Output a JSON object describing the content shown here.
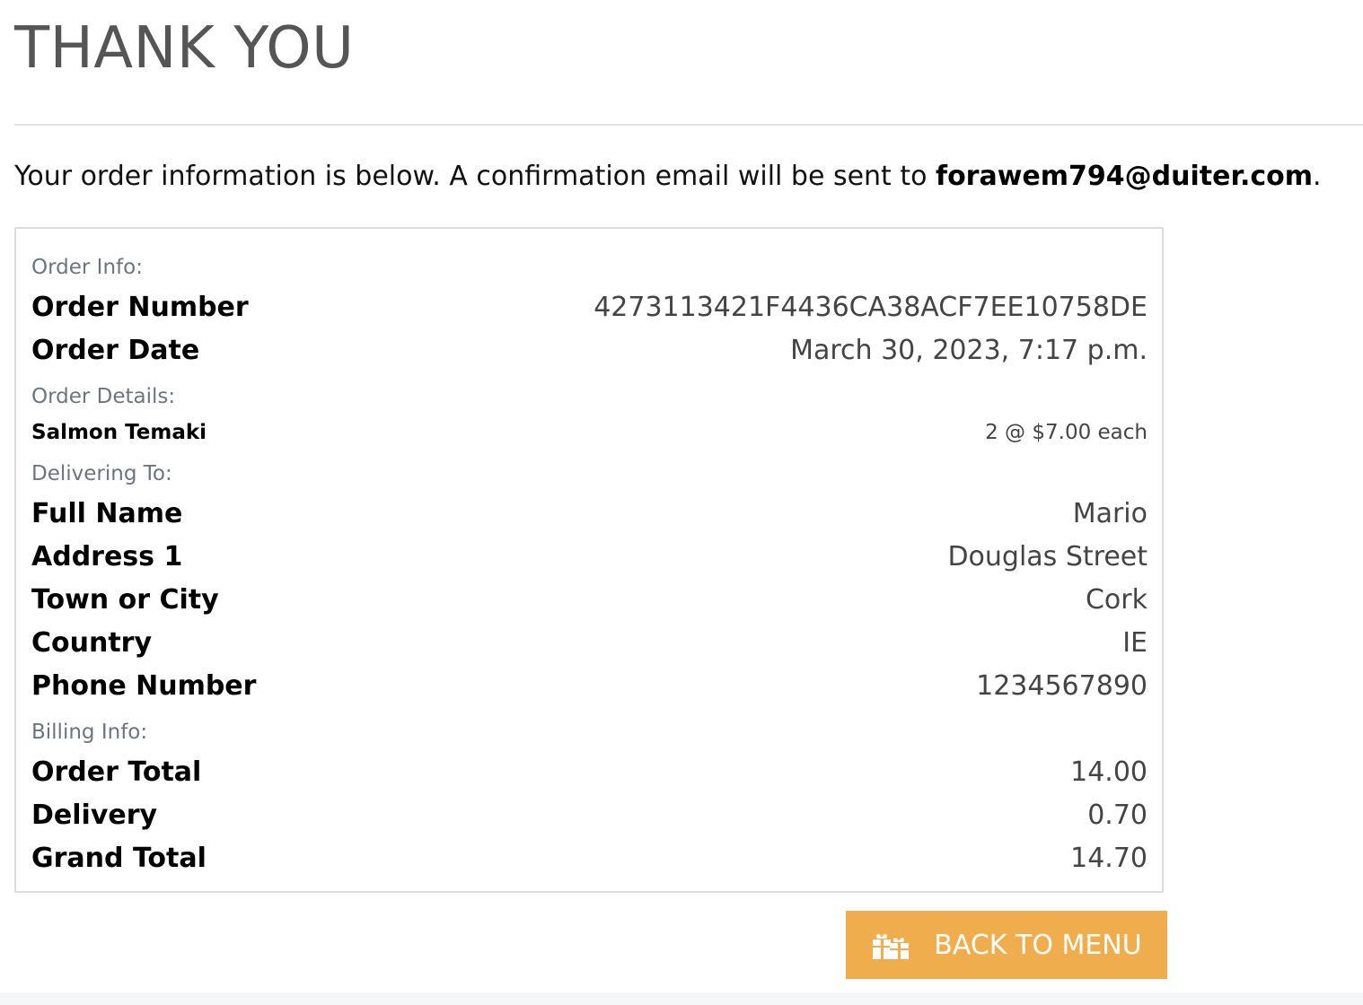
{
  "page": {
    "title": "THANK YOU",
    "intro_prefix": "Your order information is below. A confirmation email will be sent to ",
    "intro_email": "forawem794@duiter.com",
    "intro_suffix": "."
  },
  "order_info": {
    "label": "Order Info:",
    "order_number_label": "Order Number",
    "order_number": "4273113421F4436CA38ACF7EE10758DE",
    "order_date_label": "Order Date",
    "order_date": "March 30, 2023, 7:17 p.m."
  },
  "order_details": {
    "label": "Order Details:",
    "items": [
      {
        "name": "Salmon Temaki",
        "qty_price": "2 @ $7.00 each"
      }
    ]
  },
  "delivering_to": {
    "label": "Delivering To:",
    "full_name_label": "Full Name",
    "full_name": "Mario",
    "address1_label": "Address 1",
    "address1": "Douglas Street",
    "town_label": "Town or City",
    "town": "Cork",
    "country_label": "Country",
    "country": "IE",
    "phone_label": "Phone Number",
    "phone": "1234567890"
  },
  "billing_info": {
    "label": "Billing Info:",
    "order_total_label": "Order Total",
    "order_total": "14.00",
    "delivery_label": "Delivery",
    "delivery": "0.70",
    "grand_total_label": "Grand Total",
    "grand_total": "14.70"
  },
  "actions": {
    "back_label": "BACK TO MENU",
    "back_icon": "gifts-icon"
  },
  "colors": {
    "button": "#f0ad4e",
    "muted_label": "#6c757d",
    "title": "#555555"
  }
}
